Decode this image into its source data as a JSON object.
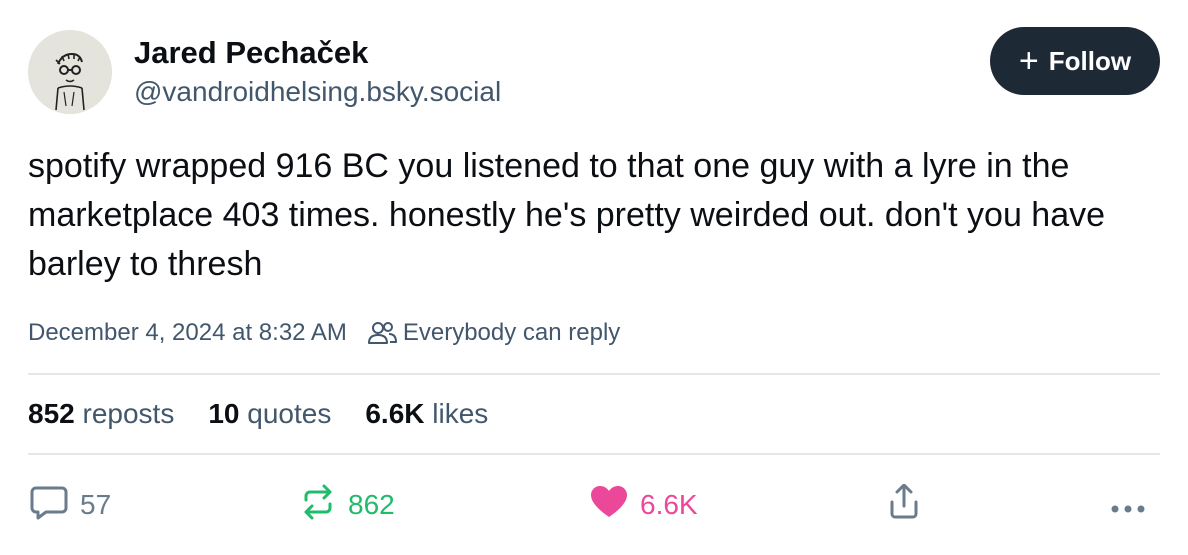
{
  "author": {
    "display_name": "Jared Pechaček",
    "handle": "@vandroidhelsing.bsky.social"
  },
  "follow_button": {
    "icon": "plus-icon",
    "label": "Follow"
  },
  "post": {
    "text": "spotify wrapped 916 BC you listened to that one guy with a lyre in the marketplace 403 times. honestly he's pretty weirded out. don't you have barley to thresh",
    "timestamp": "December 4, 2024 at 8:32 AM",
    "reply_setting_icon": "people-icon",
    "reply_setting": "Everybody can reply"
  },
  "stats": {
    "reposts_count": "852",
    "reposts_label": "reposts",
    "quotes_count": "10",
    "quotes_label": "quotes",
    "likes_count": "6.6K",
    "likes_label": "likes"
  },
  "actions": {
    "reply": {
      "icon": "speech-bubble-icon",
      "count": "57",
      "color": "#6a7b8c"
    },
    "repost": {
      "icon": "repost-arrows-icon",
      "count": "862",
      "color": "#20bc6a"
    },
    "like": {
      "icon": "heart-icon",
      "count": "6.6K",
      "color": "#ec4899"
    },
    "share": {
      "icon": "share-icon"
    },
    "more": {
      "icon": "ellipsis-icon"
    }
  },
  "colors": {
    "text": "#0b0f14",
    "secondary": "#42576c",
    "follow_bg": "#1e2936",
    "divider": "#e3e7ec"
  }
}
